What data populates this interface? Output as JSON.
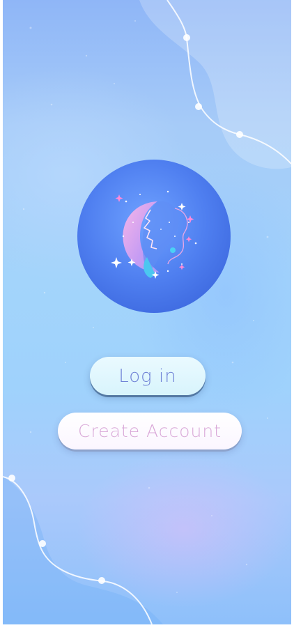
{
  "app": {
    "login_label": "Log in",
    "create_account_label": "Create Account",
    "logo_icon": "moon-face-icon"
  },
  "colors": {
    "login_text": "#6f82d6",
    "create_text": "#d9a8d8",
    "logo_circle": "#4d7ef0",
    "background": "#a3d4fb"
  }
}
